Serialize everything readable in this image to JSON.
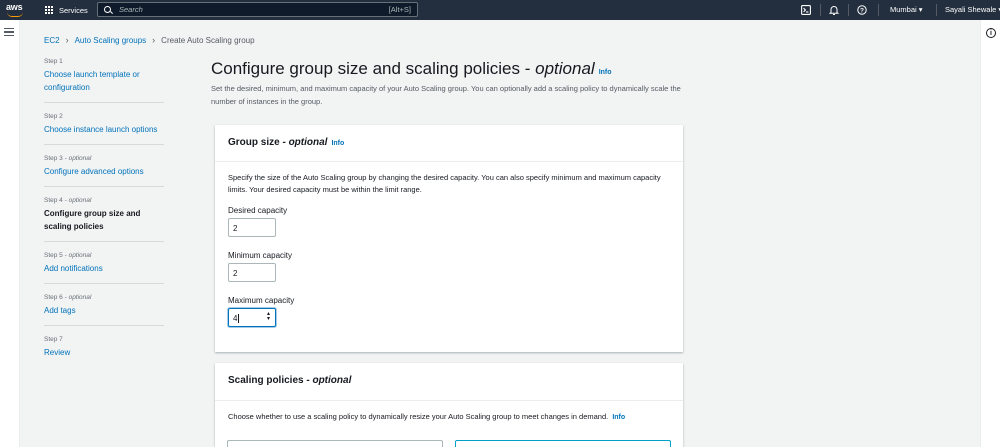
{
  "topnav": {
    "logo_text": "aws",
    "services_label": "Services",
    "search_placeholder": "Search",
    "search_shortcut": "[Alt+S]",
    "region": "Mumbai ▾",
    "user": "Sayali Shewale ▾"
  },
  "breadcrumb": {
    "items": [
      "EC2",
      "Auto Scaling groups"
    ],
    "current": "Create Auto Scaling group"
  },
  "steps": [
    {
      "num": "Step 1",
      "optional": "",
      "label": "Choose launch template or configuration",
      "current": false
    },
    {
      "num": "Step 2",
      "optional": "",
      "label": "Choose instance launch options",
      "current": false
    },
    {
      "num": "Step 3 - ",
      "optional": "optional",
      "label": "Configure advanced options",
      "current": false
    },
    {
      "num": "Step 4 - ",
      "optional": "optional",
      "label": "Configure group size and scaling policies",
      "current": true
    },
    {
      "num": "Step 5 - ",
      "optional": "optional",
      "label": "Add notifications",
      "current": false
    },
    {
      "num": "Step 6 - ",
      "optional": "optional",
      "label": "Add tags",
      "current": false
    },
    {
      "num": "Step 7",
      "optional": "",
      "label": "Review",
      "current": false
    }
  ],
  "page": {
    "title": "Configure group size and scaling policies - ",
    "title_optional": "optional",
    "info": "Info",
    "description": "Set the desired, minimum, and maximum capacity of your Auto Scaling group. You can optionally add a scaling policy to dynamically scale the number of instances in the group."
  },
  "group_size": {
    "title": "Group size - ",
    "title_optional": "optional",
    "info": "Info",
    "text": "Specify the size of the Auto Scaling group by changing the desired capacity. You can also specify minimum and maximum capacity limits. Your desired capacity must be within the limit range.",
    "desired_label": "Desired capacity",
    "desired_value": "2",
    "min_label": "Minimum capacity",
    "min_value": "2",
    "max_label": "Maximum capacity",
    "max_value": "4"
  },
  "scaling": {
    "title": "Scaling policies - ",
    "title_optional": "optional",
    "text": "Choose whether to use a scaling policy to dynamically resize your Auto Scaling group to meet changes in demand.",
    "info": "Info"
  },
  "colors": {
    "nav_bg": "#232f3e",
    "link": "#0073bb",
    "accent": "#ff9900",
    "page_bg": "#f2f3f3"
  }
}
